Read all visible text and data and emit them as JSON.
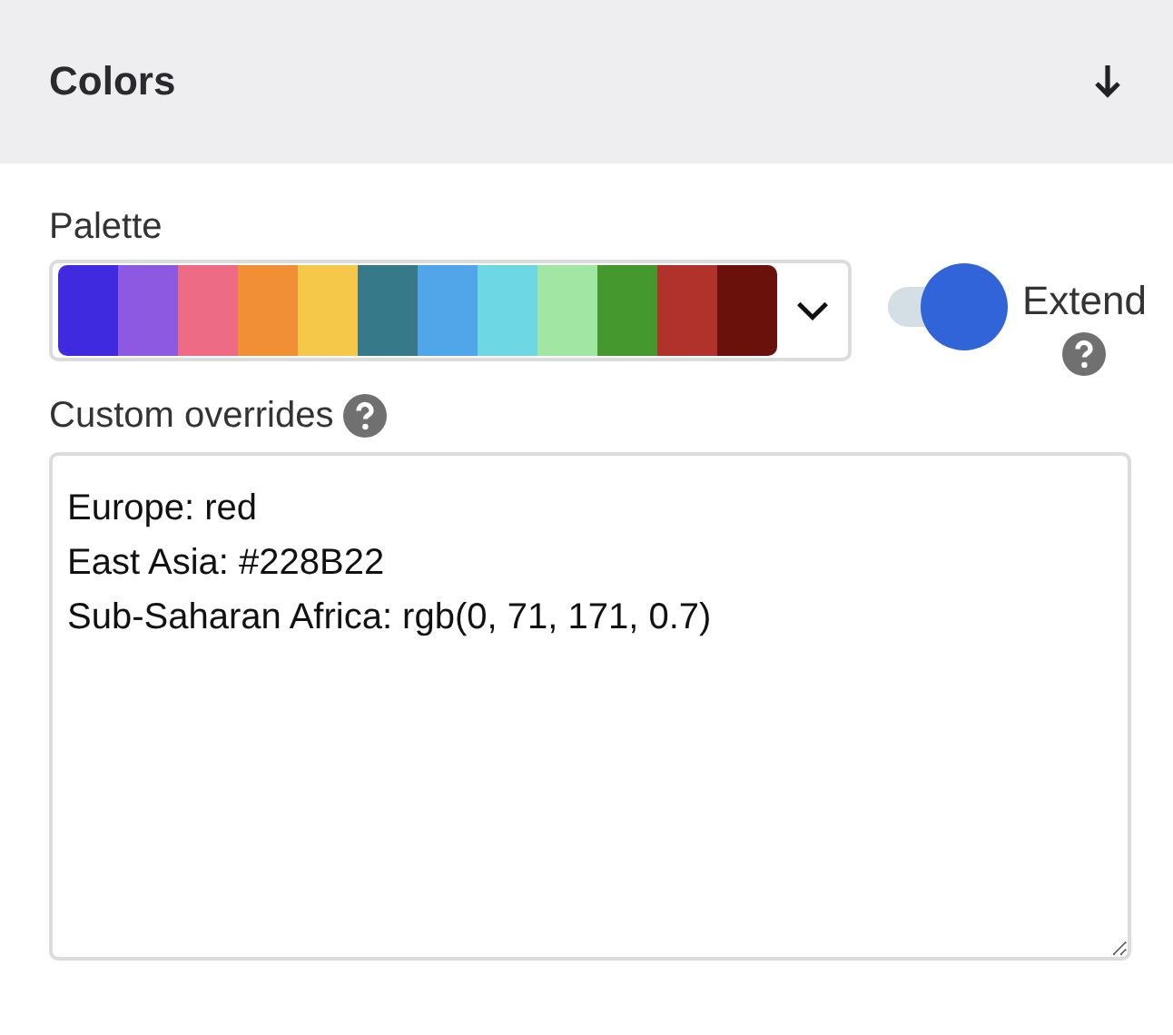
{
  "section": {
    "title": "Colors"
  },
  "palette": {
    "label": "Palette",
    "swatches": [
      {
        "color": "#3f2adf"
      },
      {
        "color": "#8d59e0"
      },
      {
        "color": "#ee6b86"
      },
      {
        "color": "#f08f36"
      },
      {
        "color": "#f6c84a"
      },
      {
        "color": "#367989"
      },
      {
        "color": "#50a6e9"
      },
      {
        "color": "#6dd8e3"
      },
      {
        "color": "#a2e6a4"
      },
      {
        "color": "#45982e"
      },
      {
        "color": "#b1322b"
      },
      {
        "color": "#6a110b"
      }
    ]
  },
  "extend": {
    "label": "Extend",
    "on": true
  },
  "overrides": {
    "label": "Custom overrides",
    "value": "Europe: red\nEast Asia: #228B22\nSub-Saharan Africa: rgb(0, 71, 171, 0.7)"
  }
}
